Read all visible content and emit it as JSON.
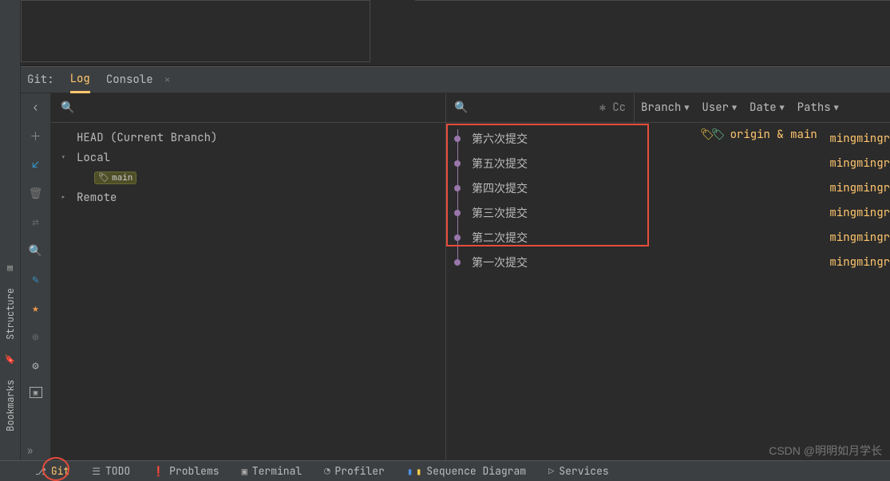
{
  "header": {
    "git_label": "Git:",
    "tab_log": "Log",
    "tab_console": "Console"
  },
  "filters": {
    "branch": "Branch",
    "user": "User",
    "date": "Date",
    "paths": "Paths",
    "regex_hint": "✱",
    "case_hint": "Cc"
  },
  "branches": {
    "head": "HEAD (Current Branch)",
    "local": "Local",
    "main": "main",
    "remote": "Remote"
  },
  "commits": [
    {
      "msg": "第六次提交",
      "author": "mingmingr",
      "head_label": "origin & main"
    },
    {
      "msg": "第五次提交",
      "author": "mingmingr"
    },
    {
      "msg": "第四次提交",
      "author": "mingmingr"
    },
    {
      "msg": "第三次提交",
      "author": "mingmingr"
    },
    {
      "msg": "第二次提交",
      "author": "mingmingr"
    },
    {
      "msg": "第一次提交",
      "author": "mingmingr"
    }
  ],
  "bottom": {
    "git": "Git",
    "todo": "TODO",
    "problems": "Problems",
    "terminal": "Terminal",
    "profiler": "Profiler",
    "sequence": "Sequence Diagram",
    "services": "Services"
  },
  "rail": {
    "structure": "Structure",
    "bookmarks": "Bookmarks"
  },
  "watermark": "CSDN @明明如月学长"
}
